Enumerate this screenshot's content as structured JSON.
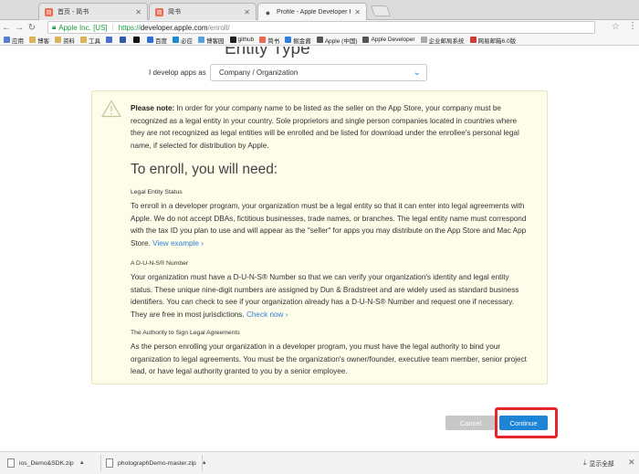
{
  "tabs": [
    {
      "label": "首页 - 简书",
      "icon": "jianshu-favicon"
    },
    {
      "label": "简书",
      "icon": "jianshu-favicon"
    },
    {
      "label": "Profile - Apple Developer Prog",
      "icon": "apple-favicon"
    }
  ],
  "address": {
    "secure_label": "Apple Inc. [US]",
    "url_scheme": "https://",
    "url_host": "developer.apple.com",
    "url_path": "/enroll/"
  },
  "bookmarks": [
    {
      "label": "应用",
      "color": "#5b7fd0"
    },
    {
      "label": "博客",
      "color": "#d8b35a"
    },
    {
      "label": "资料",
      "color": "#d8b35a"
    },
    {
      "label": "工具",
      "color": "#d8b35a"
    },
    {
      "label": "",
      "color": "#4a6fc8"
    },
    {
      "label": "",
      "color": "#2f5ca8"
    },
    {
      "label": "",
      "color": "#111111"
    },
    {
      "label": "百度",
      "color": "#2f6fd6"
    },
    {
      "label": "必应",
      "color": "#1a8bd0"
    },
    {
      "label": "博客园",
      "color": "#5aa0d8"
    },
    {
      "label": "github",
      "color": "#222222"
    },
    {
      "label": "简书",
      "color": "#e9684f"
    },
    {
      "label": "掘金酱",
      "color": "#2f7fe0"
    },
    {
      "label": "Apple (中国)",
      "color": "#555555"
    },
    {
      "label": "Apple Developer",
      "color": "#555555"
    },
    {
      "label": "企业邮局系统",
      "color": "#aaaaaa"
    },
    {
      "label": "网易邮箱6.0版",
      "color": "#d03b3b"
    }
  ],
  "page": {
    "heading": "Entity Type",
    "develop_label": "I develop apps as",
    "develop_value": "Company / Organization",
    "note_lead": "Please note:",
    "note_text": " In order for your company name to be listed as the seller on the App Store, your company must be recognized as a legal entity in your country. Sole proprietors and single person companies located in countries where they are not recognized as legal entities will be enrolled and be listed for download under the enrollee's personal legal name, if selected for distribution by Apple.",
    "enroll_heading": "To enroll, you will need:",
    "sections": [
      {
        "title": "Legal Entity Status",
        "body": "To enroll in a developer program, your organization must be a legal entity so that it can enter into legal agreements with Apple. We do not accept DBAs, fictitious businesses, trade names, or branches. The legal entity name must correspond with the tax ID you plan to use and will appear as the \"seller\" for apps you may distribute on the App Store and Mac App Store. ",
        "link": "View example ›"
      },
      {
        "title": "A D-U-N-S® Number",
        "body": "Your organization must have a D-U-N-S® Number so that we can verify your organization's identity and legal entity status. These unique nine-digit numbers are assigned by Dun & Bradstreet and are widely used as standard business identifiers. You can check to see if your organization already has a D-U-N-S® Number and request one if necessary. They are free in most jurisdictions. ",
        "link": "Check now ›"
      },
      {
        "title": "The Authority to Sign Legal Agreements",
        "body": "As the person enrolling your organization in a developer program, you must have the legal authority to bind your organization to legal agreements. You must be the organization's owner/founder, executive team member, senior project lead, or have legal authority granted to you by a senior employee.",
        "link": ""
      }
    ],
    "cancel_label": "Cancel",
    "continue_label": "Continue"
  },
  "downloads": {
    "items": [
      {
        "name": "ios_Demo&SDK.zip"
      },
      {
        "name": "photographDemo-master.zip"
      }
    ],
    "show_all": "显示全部"
  }
}
